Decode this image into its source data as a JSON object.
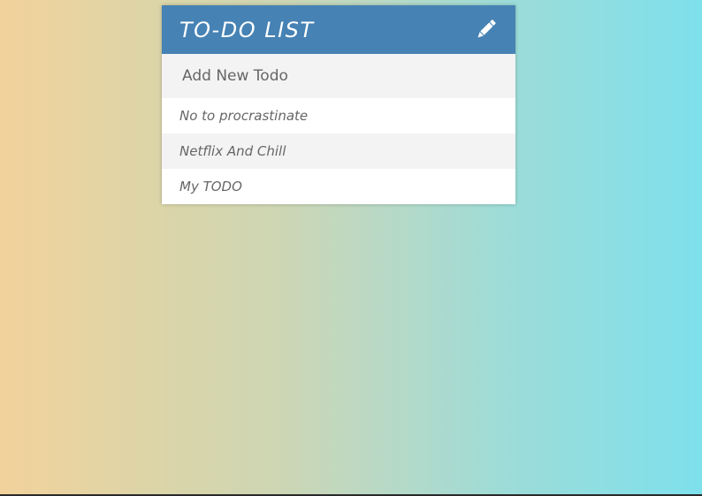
{
  "header": {
    "title": "TO-DO LIST",
    "edit_icon": "pencil-icon",
    "color": "#4682b4"
  },
  "add_todo": {
    "placeholder": "Add New Todo",
    "value": ""
  },
  "todos": [
    {
      "text": "No to procrastinate"
    },
    {
      "text": "Netflix And Chill"
    },
    {
      "text": "My TODO"
    }
  ],
  "background": {
    "gradient_start": "#f2d29c",
    "gradient_end": "#7ee0ec"
  }
}
